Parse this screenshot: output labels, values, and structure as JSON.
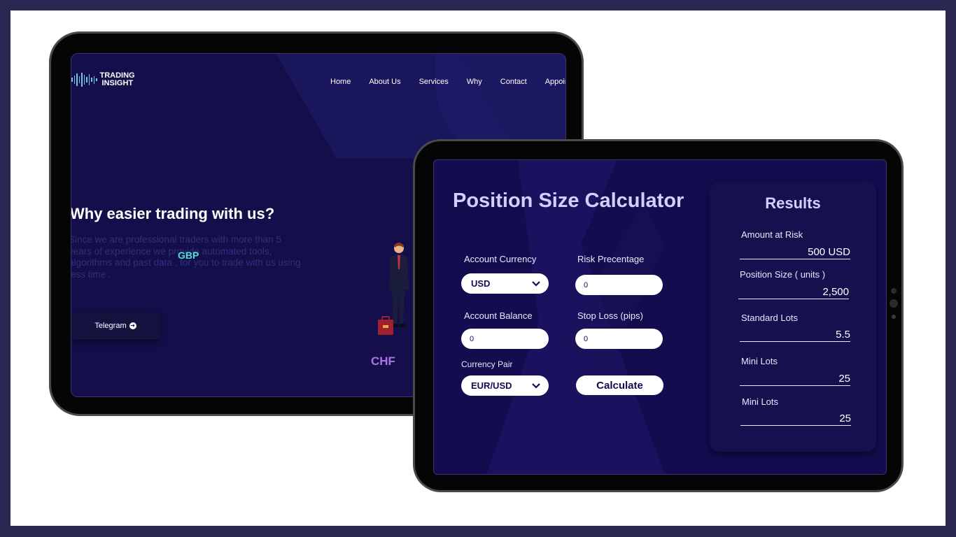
{
  "website": {
    "logo": {
      "line1": "TRADING",
      "line2": "INSIGHT"
    },
    "nav": [
      "Home",
      "About Us",
      "Services",
      "Why",
      "Contact",
      "Appoin"
    ],
    "hero": {
      "title": "Why easier trading with us?",
      "text": "Since we are professional traders with more than 5 years of experience we provide automated tools, algorithms and past data , for you to trade with us using less time ."
    },
    "currency_tags": [
      "GBP",
      "CHF"
    ],
    "telegram_button": "Telegram"
  },
  "calculator": {
    "title": "Position Size Calculator",
    "account_currency": {
      "label": "Account Currency",
      "value": "USD"
    },
    "risk_percentage": {
      "label": "Risk Precentage",
      "value": "0"
    },
    "account_balance": {
      "label": "Account Balance",
      "value": "0"
    },
    "stop_loss": {
      "label": "Stop Loss (pips)",
      "value": "0"
    },
    "currency_pair": {
      "label": "Currency Pair",
      "value": "EUR/USD"
    },
    "calculate_button": "Calculate"
  },
  "results": {
    "title": "Results",
    "items": [
      {
        "label": "Amount at Risk",
        "value": "500 USD"
      },
      {
        "label": "Position Size ( units )",
        "value": "2,500"
      },
      {
        "label": "Standard Lots",
        "value": "5.5"
      },
      {
        "label": "Mini Lots",
        "value": "25"
      },
      {
        "label": "Mini Lots",
        "value": "25"
      }
    ]
  },
  "colors": {
    "frame": "#2a2850",
    "screen_bg": "#140f4a",
    "accent_text": "#cfd2ff",
    "gbp": "#4fe0d0",
    "chf": "#b070e8"
  },
  "icons": [
    "sound-wave-logo-icon",
    "arrow-circle-right-icon",
    "chevron-down-icon"
  ]
}
